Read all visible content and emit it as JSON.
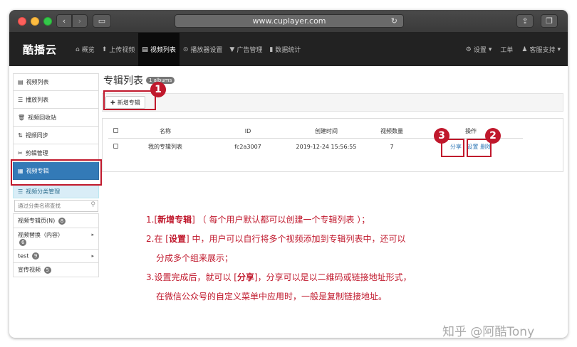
{
  "browser": {
    "url": "www.cuplayer.com"
  },
  "app": {
    "logo": "酷播云",
    "nav": [
      {
        "icon": "home-icon",
        "glyph": "⌂",
        "label": "概览",
        "active": false
      },
      {
        "icon": "upload-icon",
        "glyph": "⬆",
        "label": "上传视频",
        "active": false
      },
      {
        "icon": "film-icon",
        "glyph": "▤",
        "label": "视频列表",
        "active": true
      },
      {
        "icon": "play-icon",
        "glyph": "⊙",
        "label": "播放器设置",
        "active": false
      },
      {
        "icon": "filter-icon",
        "glyph": "▼",
        "label": "广告管理",
        "active": false
      },
      {
        "icon": "chart-icon",
        "glyph": "▮",
        "label": "数据统计",
        "active": false
      }
    ],
    "right_nav": {
      "settings": "设置",
      "ticket": "工单",
      "support": "客服支持"
    }
  },
  "sidebar": {
    "items": [
      {
        "glyph": "▤",
        "label": "视频列表"
      },
      {
        "glyph": "☰",
        "label": "播放列表"
      },
      {
        "glyph": "🗑",
        "label": "视频回收站"
      },
      {
        "glyph": "⇅",
        "label": "视频同步"
      },
      {
        "glyph": "✂",
        "label": "剪辑管理"
      },
      {
        "glyph": "▦",
        "label": "视频专辑"
      }
    ],
    "category": {
      "header": "视频分类管理",
      "search_placeholder": "通过分类名称查找",
      "entries": [
        {
          "label": "视频专辑页(N)",
          "count": "8"
        },
        {
          "label": "视频替换（内容）",
          "count": "6"
        },
        {
          "label": "test",
          "count": "9"
        },
        {
          "label": "宣传视频",
          "count": "5"
        }
      ]
    }
  },
  "main": {
    "title": "专辑列表",
    "title_badge": "1 albums",
    "add_button": "新增专辑",
    "table": {
      "headers": [
        "名称",
        "ID",
        "创建时间",
        "视频数量",
        "操作"
      ],
      "rows": [
        {
          "name": "我的专辑列表",
          "id": "fc2a3007",
          "created": "2019-12-24 15:56:55",
          "count": "7",
          "share": "分享",
          "settings": "设置",
          "delete": "删除"
        }
      ]
    }
  },
  "markers": [
    "1",
    "2",
    "3"
  ],
  "notes": {
    "line1_pre": "1.[",
    "line1_bold": "新增专辑",
    "line1_post": "] （ 每个用户默认都可以创建一个专辑列表 ）；",
    "line2_pre": "2.在 [",
    "line2_bold": "设置",
    "line2_post": "] 中，用户可以自行将多个视频添加到专辑列表中，还可以",
    "line3": "分成多个组来展示；",
    "line4_pre": "3.设置完成后，就可以 [",
    "line4_bold": "分享",
    "line4_post": "]，分享可以是以二维码或链接地址形式，",
    "line5": "在微信公众号的自定义菜单中应用时，一般是复制链接地址。"
  },
  "watermark": "知乎 @阿酷Tony"
}
